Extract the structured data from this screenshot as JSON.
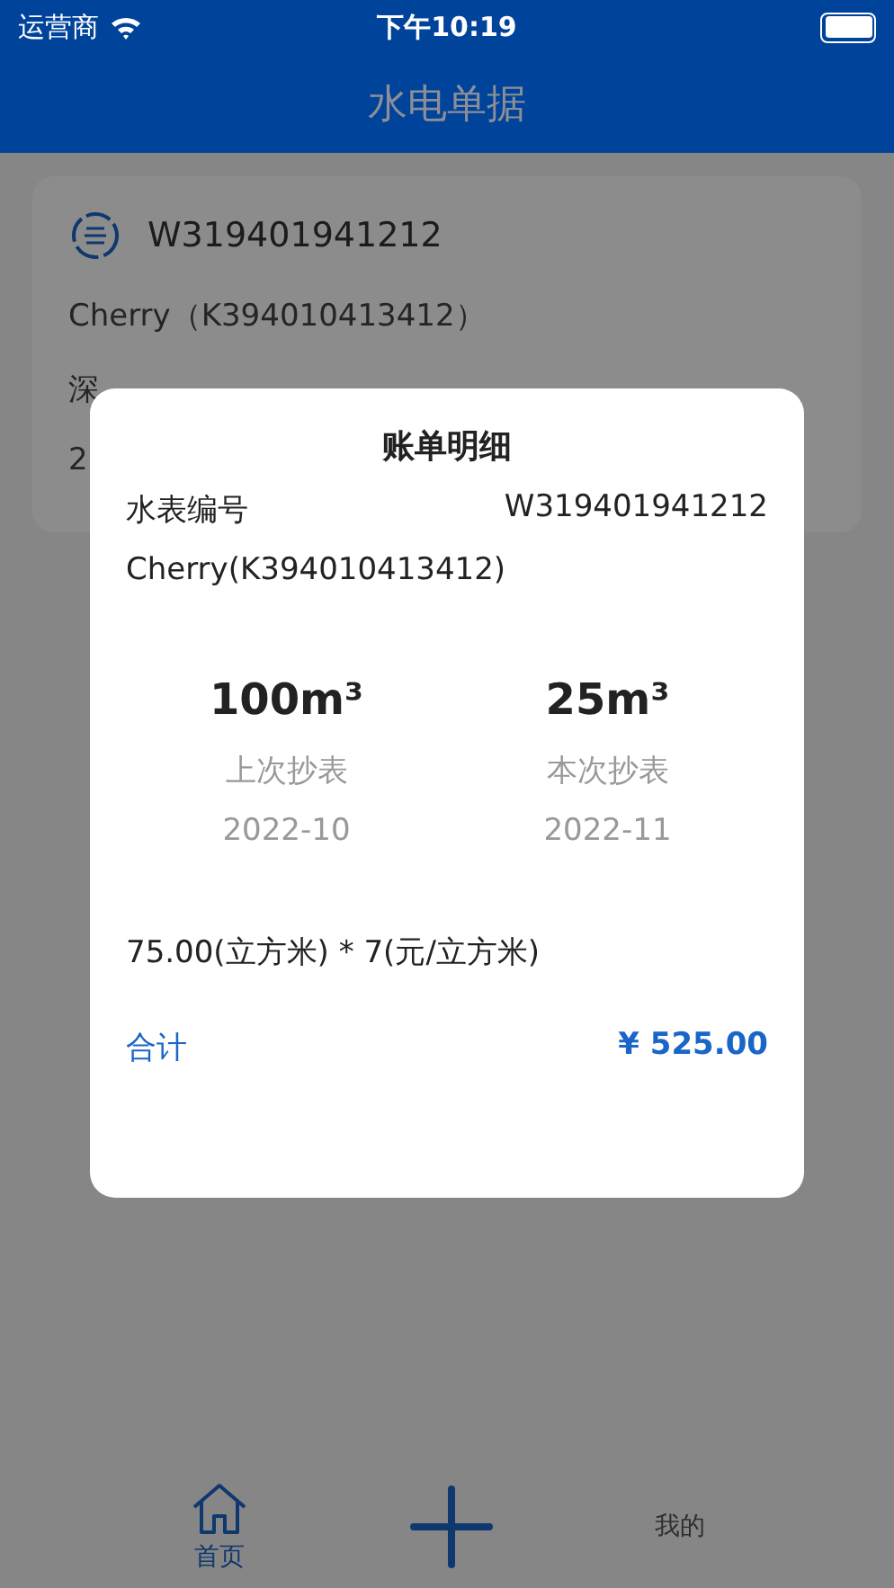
{
  "status_bar": {
    "carrier": "运营商",
    "time": "下午10:19"
  },
  "nav": {
    "title": "水电单据"
  },
  "card": {
    "meter_no": "W319401941212",
    "tenant": "Cherry（K394010413412）",
    "address": "深",
    "date": "2"
  },
  "dialog": {
    "title": "账单明细",
    "meter_label": "水表编号",
    "meter_no": "W319401941212",
    "tenant": "Cherry(K394010413412)",
    "readings": [
      {
        "value": "100m³",
        "label": "上次抄表",
        "month": "2022-10"
      },
      {
        "value": "25m³",
        "label": "本次抄表",
        "month": "2022-11"
      }
    ],
    "formula": "75.00(立方米) * 7(元/立方米)",
    "total_label": "合计",
    "total": "¥ 525.00"
  },
  "tabs": [
    {
      "kind": "home",
      "label": "首页",
      "selected": true
    },
    {
      "kind": "mine",
      "label": "我的",
      "selected": false
    }
  ]
}
